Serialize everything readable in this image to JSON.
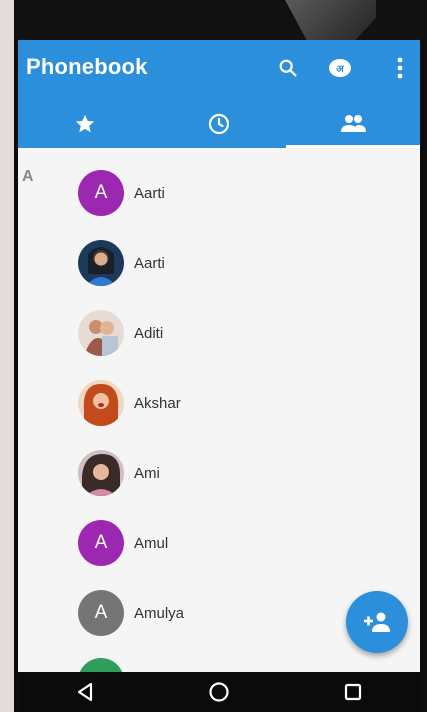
{
  "app": {
    "title": "Phonebook"
  },
  "toolbar": {
    "icons": [
      "search-icon",
      "language-icon",
      "more-vert-icon"
    ]
  },
  "tabs": [
    {
      "icon": "star-icon",
      "active": false
    },
    {
      "icon": "clock-icon",
      "active": false
    },
    {
      "icon": "people-icon",
      "active": true
    }
  ],
  "contacts": {
    "section_letter": "A",
    "items": [
      {
        "name": "Aarti",
        "avatar_type": "letter",
        "letter": "A",
        "color": "#9c27b0"
      },
      {
        "name": "Aarti",
        "avatar_type": "photo"
      },
      {
        "name": "Aditi",
        "avatar_type": "photo"
      },
      {
        "name": "Akshar",
        "avatar_type": "photo"
      },
      {
        "name": "Ami",
        "avatar_type": "photo"
      },
      {
        "name": "Amul",
        "avatar_type": "letter",
        "letter": "A",
        "color": "#9c27b0"
      },
      {
        "name": "Amulya",
        "avatar_type": "letter",
        "letter": "A",
        "color": "#757575"
      }
    ]
  },
  "fab": {
    "icon": "add-person-icon"
  },
  "colors": {
    "primary": "#2c8fdb",
    "accent_purple": "#9c27b0",
    "grey_avatar": "#757575"
  }
}
